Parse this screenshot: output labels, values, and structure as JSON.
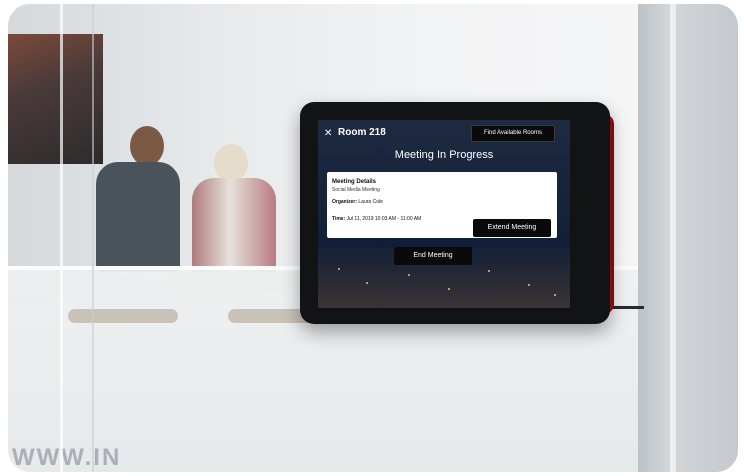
{
  "device": {
    "close_glyph": "✕",
    "room_name": "Room 218",
    "find_rooms_label": "Find Available Rooms",
    "status": "Meeting In Progress",
    "details": {
      "heading": "Meeting Details",
      "meeting_name": "Social Media Meeting",
      "organizer_label": "Organizer:",
      "organizer": "Laura Cole",
      "time_label": "Time:",
      "time": "Jul 11, 2019 10:03 AM - 11:00 AM"
    },
    "extend_label": "Extend Meeting",
    "end_label": "End Meeting",
    "led_color": "#c01824"
  },
  "background": {
    "watermark": "WWW.IN"
  }
}
